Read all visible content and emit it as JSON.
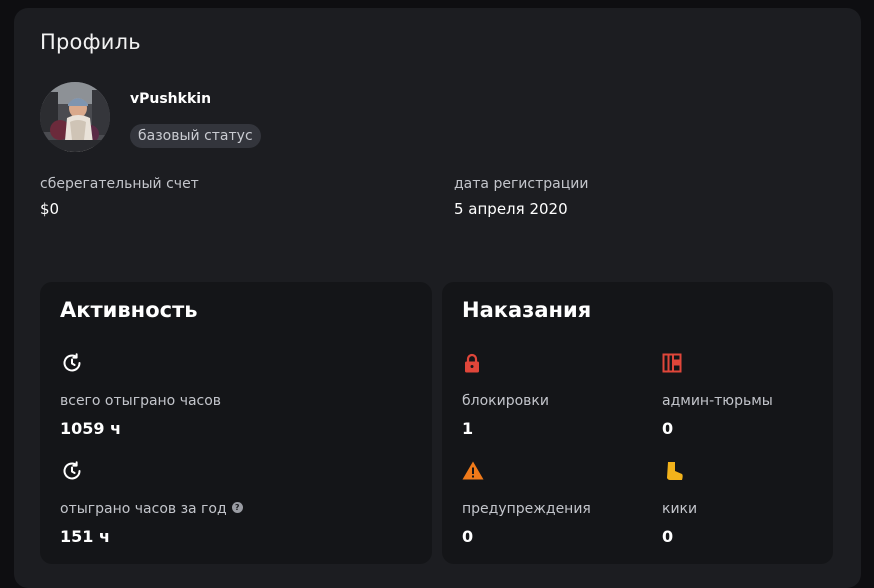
{
  "profile": {
    "title": "Профиль",
    "username": "vPushkkin",
    "status": "базовый статус"
  },
  "info": {
    "savings_label": "сберегательный счет",
    "savings_value": "$0",
    "registration_label": "дата регистрации",
    "registration_value": "5 апреля 2020"
  },
  "activity": {
    "title": "Активность",
    "total_hours_label": "всего отыграно часов",
    "total_hours_value": "1059 ч",
    "year_hours_label": "отыграно часов за год",
    "year_hours_value": "151 ч",
    "help_glyph": "?"
  },
  "punishments": {
    "title": "Наказания",
    "bans_label": "блокировки",
    "bans_value": "1",
    "jails_label": "админ-тюрьмы",
    "jails_value": "0",
    "warnings_label": "предупреждения",
    "warnings_value": "0",
    "kicks_label": "кики",
    "kicks_value": "0"
  },
  "icons": {
    "clock": "clock-icon",
    "lock": "lock-icon",
    "jail": "jail-icon",
    "warning": "warning-icon",
    "boot": "boot-icon",
    "help": "help-icon"
  },
  "colors": {
    "background": "#0e0e11",
    "panel": "#1c1d21",
    "card": "#141518",
    "danger": "#e0463a",
    "warning": "#f07a1a",
    "kick": "#f2b21b"
  }
}
